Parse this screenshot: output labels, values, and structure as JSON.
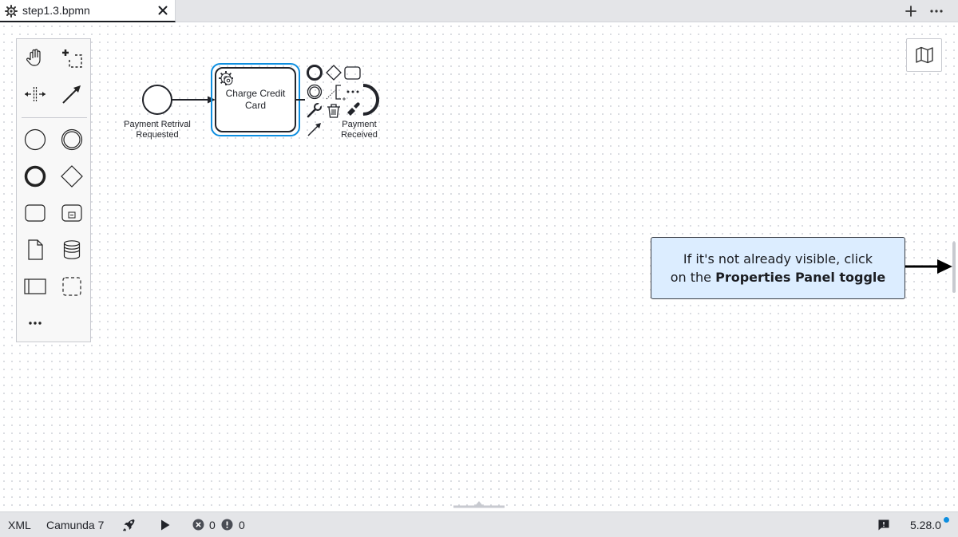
{
  "tab": {
    "title": "step1.3.bpmn"
  },
  "diagram": {
    "start_event_label_line1": "Payment Retrival",
    "start_event_label_line2": "Requested",
    "task_label_line1": "Charge Credit",
    "task_label_line2": "Card",
    "end_event_label_line1": "Payment",
    "end_event_label_line2": "Received"
  },
  "callout": {
    "text_line1": "If it's not already visible, click",
    "text_line2_prefix": "on the ",
    "text_line2_bold": "Properties Panel toggle"
  },
  "statusbar": {
    "xml_label": "XML",
    "engine_label": "Camunda 7",
    "error_count": "0",
    "warning_count": "0",
    "version": "5.28.0"
  },
  "colors": {
    "selection": "#0d8ee0",
    "callout_bg": "#dcedff"
  }
}
